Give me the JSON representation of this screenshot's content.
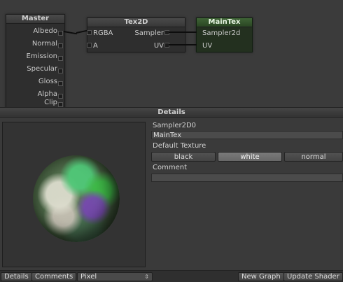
{
  "nodes": {
    "master": {
      "title": "Master",
      "ports": [
        "Albedo",
        "Normal",
        "Emission",
        "Specular",
        "Gloss",
        "Alpha",
        "Clip"
      ]
    },
    "tex2d": {
      "title": "Tex2D",
      "inputs": [
        "RGBA",
        "A"
      ],
      "outputs": [
        "Sampler",
        "UV"
      ]
    },
    "maintex": {
      "title": "MainTex",
      "ports": [
        "Sampler2d",
        "UV"
      ]
    }
  },
  "details": {
    "header": "Details",
    "variable_label": "Sampler2D0",
    "variable_value": "MainTex",
    "default_texture_label": "Default Texture",
    "texture_options": [
      "black",
      "white",
      "normal"
    ],
    "selected_texture": "white",
    "comment_label": "Comment",
    "comment_value": ""
  },
  "toolbar": {
    "details_tab": "Details",
    "comments_tab": "Comments",
    "precision_value": "Pixel",
    "new_graph": "New Graph",
    "update_shader": "Update Shader"
  },
  "colors": {
    "maintex_header": "#3f6336",
    "background": "#3a3a3a"
  }
}
